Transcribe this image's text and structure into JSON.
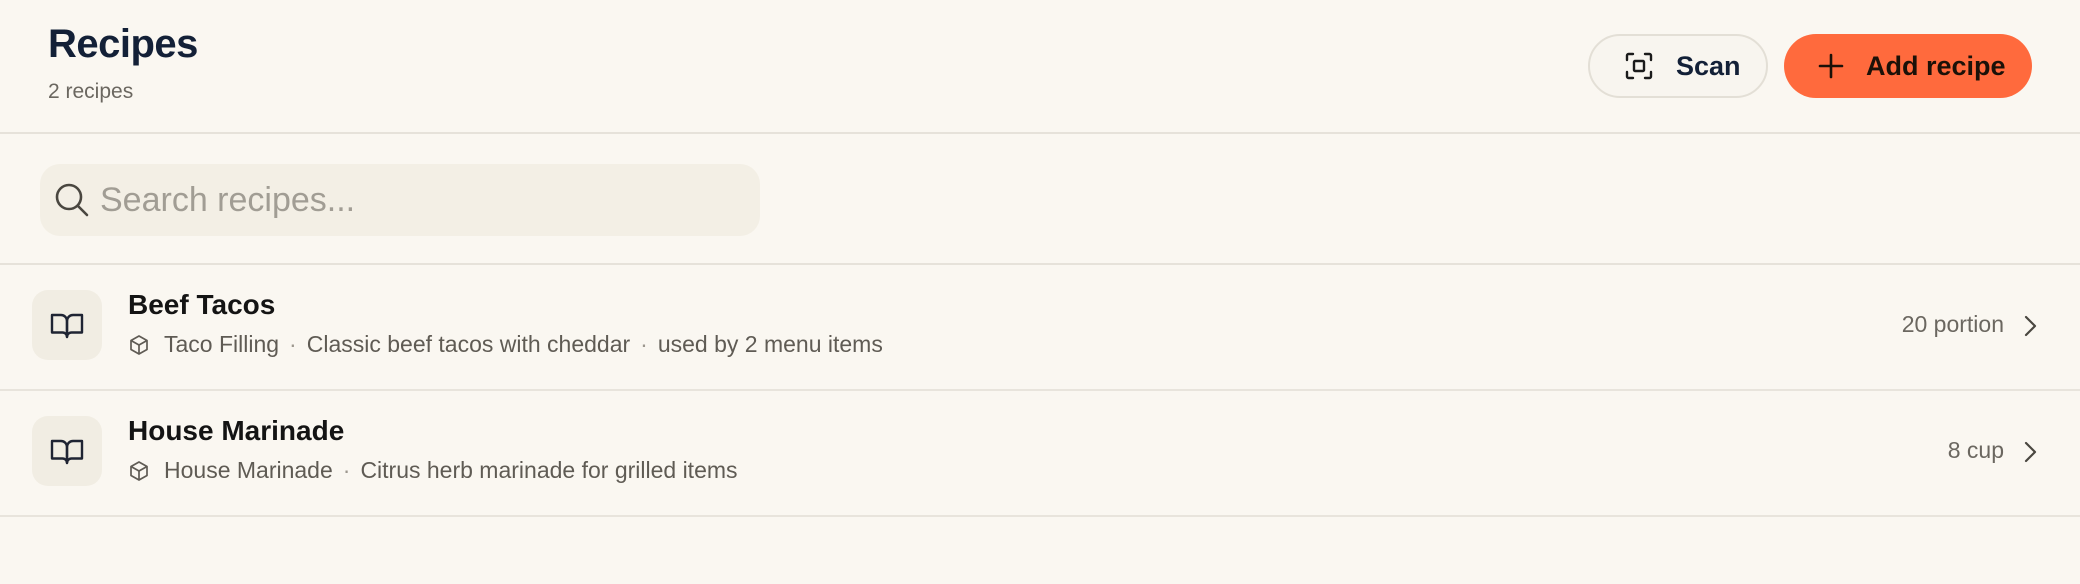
{
  "header": {
    "title": "Recipes",
    "subtitle": "2 recipes",
    "scan_label": "Scan",
    "add_label": "Add recipe"
  },
  "search": {
    "placeholder": "Search recipes...",
    "value": ""
  },
  "recipes": [
    {
      "name": "Beef Tacos",
      "component": "Taco Filling",
      "description": "Classic beef tacos with cheddar",
      "usage": "used by 2 menu items",
      "yield": "20 portion"
    },
    {
      "name": "House Marinade",
      "component": "House Marinade",
      "description": "Citrus herb marinade for grilled items",
      "usage": "",
      "yield": "8 cup"
    }
  ],
  "icons": {
    "scan": "scan-icon",
    "add": "plus-icon",
    "search": "search-icon",
    "recipe": "book-open-icon",
    "component": "cube-icon",
    "row_action": "chevron-right-icon"
  },
  "colors": {
    "accent": "#ff6a3d",
    "background": "#faf7f1",
    "title": "#132037"
  }
}
